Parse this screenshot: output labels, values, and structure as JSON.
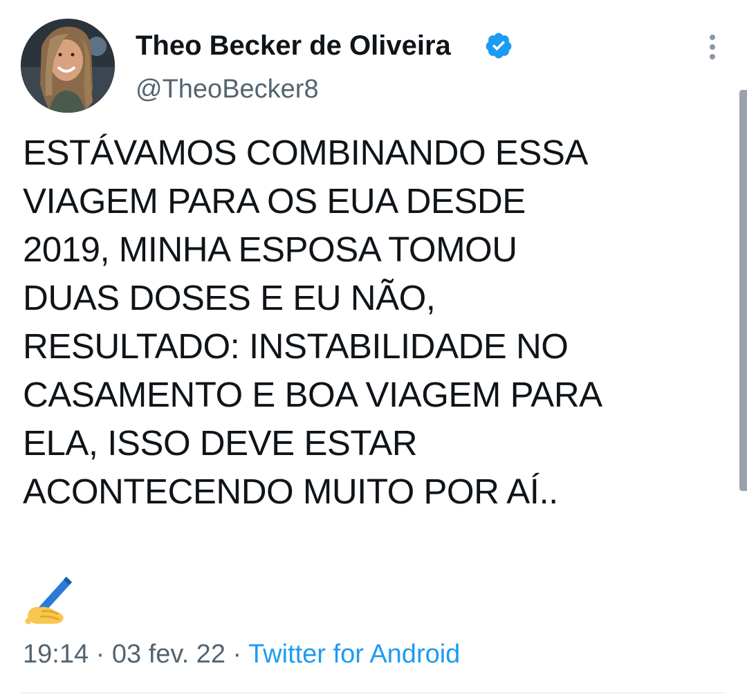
{
  "author": {
    "display_name": "Theo Becker de Oliveira",
    "handle": "@TheoBecker8",
    "verified": true,
    "avatar_icon": "profile-photo"
  },
  "tweet": {
    "lines": [
      "ESTÁVAMOS COMBINANDO ESSA",
      "VIAGEM PARA OS EUA DESDE",
      "2019, MINHA ESPOSA TOMOU",
      "DUAS DOSES E EU NÃO,",
      "RESULTADO: INSTABILIDADE NO",
      "CASAMENTO E BOA VIAGEM PARA",
      "ELA, ISSO DEVE ESTAR",
      "ACONTECENDO MUITO POR AÍ.."
    ],
    "emoji": "writing-hand"
  },
  "meta": {
    "time": "19:14",
    "separator1": " · ",
    "date": "03 fev. 22",
    "separator2": " · ",
    "source": "Twitter for Android"
  },
  "colors": {
    "text": "#0f1419",
    "secondary": "#536471",
    "link": "#1d9bf0",
    "verified": "#1d9bf0"
  }
}
